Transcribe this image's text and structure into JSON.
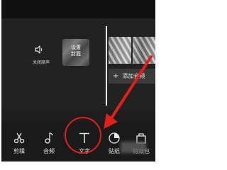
{
  "editor": {
    "mute_label": "关闭原声",
    "cover_label": "设置\n封面",
    "add_audio_label": "添加音频"
  },
  "toolbar": {
    "items": [
      {
        "label": "剪辑",
        "icon": "scissors-icon"
      },
      {
        "label": "音频",
        "icon": "music-note-icon"
      },
      {
        "label": "文字",
        "icon": "text-icon"
      },
      {
        "label": "贴纸",
        "icon": "sticker-icon"
      },
      {
        "label": "特效包",
        "icon": "effects-icon"
      }
    ]
  },
  "annotation": {
    "color": "#e0211b"
  }
}
